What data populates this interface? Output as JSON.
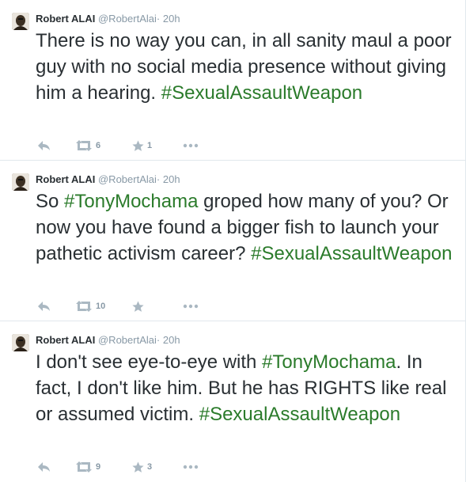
{
  "tweets": [
    {
      "author_name": "Robert ALAI",
      "handle": "@RobertAlai",
      "separator": "·",
      "time": "20h",
      "text_parts": [
        {
          "text": "There is no way you can, in all sanity maul a poor guy with no social media presence without giving him a hearing. "
        },
        {
          "text": "#SexualAssaultWeapon",
          "hashtag": true
        }
      ],
      "retweet_count": "6",
      "favorite_count": "1"
    },
    {
      "author_name": "Robert ALAI",
      "handle": "@RobertAlai",
      "separator": "·",
      "time": "20h",
      "text_parts": [
        {
          "text": "So "
        },
        {
          "text": "#TonyMochama",
          "hashtag": true
        },
        {
          "text": " groped how many of you? Or now you have found a bigger fish to launch your pathetic activism career? "
        },
        {
          "text": "#SexualAssaultWeapon",
          "hashtag": true
        }
      ],
      "retweet_count": "10",
      "favorite_count": ""
    },
    {
      "author_name": "Robert ALAI",
      "handle": "@RobertAlai",
      "separator": "·",
      "time": "20h",
      "text_parts": [
        {
          "text": "I don't see eye-to-eye with "
        },
        {
          "text": "#TonyMochama",
          "hashtag": true
        },
        {
          "text": ". In fact, I don't like him. But he has RIGHTS like real or assumed victim. "
        },
        {
          "text": "#SexualAssaultWeapon",
          "hashtag": true
        }
      ],
      "retweet_count": "9",
      "favorite_count": "3"
    }
  ],
  "icons": {
    "reply": "reply-icon",
    "retweet": "retweet-icon",
    "favorite": "star-icon",
    "more": "more-icon"
  },
  "colors": {
    "hashtag": "#2b7b2b",
    "text": "#292f33",
    "meta": "#8899a6",
    "action_icon": "#aab8c2"
  }
}
